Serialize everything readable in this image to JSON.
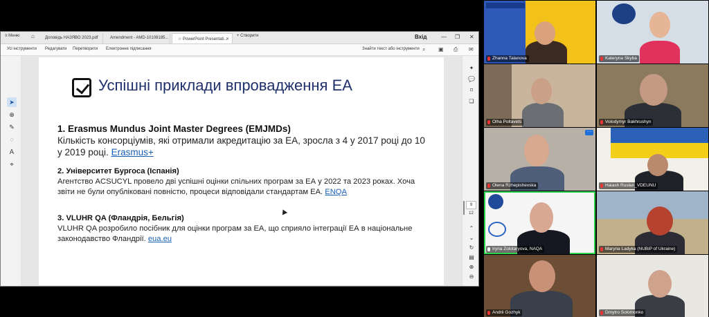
{
  "tabbar": {
    "menu_label": "Меню",
    "tabs": [
      {
        "label": "Доповідь НАЗЯВО 2023.pdf"
      },
      {
        "label": "Amendment - AMD-10108185..."
      },
      {
        "label": "PowerPoint Presentati..."
      }
    ],
    "new_tab_label": "+ Створити",
    "sign_in_label": "Вхід"
  },
  "toolbar": {
    "items": [
      "Усі інструменти",
      "Редагувати",
      "Перетворити",
      "Електронне підписання"
    ],
    "search_text_label": "Знайти текст або інструменти"
  },
  "slide": {
    "title": "Успішні приклади впровадження ЕА",
    "item1": {
      "heading": "1. Erasmus Mundus Joint Master Degrees (EMJMDs)",
      "body": "Кількість консорціумів, які отримали акредитацію за ЕА, зросла з 4 у 2017 році до 10 у 2019 році.",
      "link": "Erasmus+"
    },
    "item2": {
      "heading": "2. Університет Бургоса (Іспанія)",
      "body": "Агентство ACSUCYL провело дві успішні оцінки спільних програм за ЕА у 2022 та 2023 роках. Хоча звіти не були опубліковані повністю, процеси відповідали стандартам ЕА.",
      "link": "ENQA"
    },
    "item3": {
      "heading": "3. VLUHR QA (Фландрія, Бельгія)",
      "body": "VLUHR QA розробило посібник для оцінки програм за ЕА, що сприяло інтеграції ЕА в національне законодавство Фландрії.",
      "link": "eua.eu"
    }
  },
  "pager": {
    "current": "9",
    "total": "12"
  },
  "participants": [
    {
      "name": "Zhanna Talanova"
    },
    {
      "name": "Kateryna Skyba"
    },
    {
      "name": "Olha Poltavets"
    },
    {
      "name": "Volodymyr Bakhrushyn"
    },
    {
      "name": "Olena Rzhepishevska"
    },
    {
      "name": "Haiash Ruslan_VDEUNU"
    },
    {
      "name": "Iryna Zolotaryova, NAQA"
    },
    {
      "name": "Maryna Ladyka (NUBiP of Ukraine)"
    },
    {
      "name": "Andrii Gozhyk"
    },
    {
      "name": "Dmytro Solomonko"
    }
  ],
  "colors": {
    "title_blue": "#1e2f6b",
    "link_blue": "#1a5fb4",
    "speaking_green": "#2bd24b",
    "mic_muted_red": "#e33333"
  }
}
